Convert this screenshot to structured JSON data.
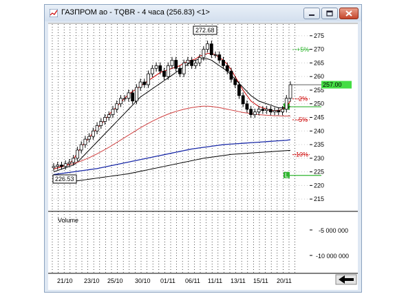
{
  "window": {
    "title": "ГАЗПРОМ ао - TQBR - 4 часа (256.83) <1>"
  },
  "icons": {
    "app": "chart-icon",
    "minimize": "minimize-icon",
    "maximize": "maximize-icon",
    "close": "close-icon",
    "scroll": "scroll-left-arrow-icon"
  },
  "colors": {
    "up_candle": "#ffffff",
    "down_candle": "#000000",
    "ma_fast": "#cc0000",
    "ma_slow": "#000000",
    "ma_50": "#d04040",
    "ma_100": "#1a2aa8",
    "ma_200": "#000000",
    "level_green": "#2fb52f",
    "level_red": "#cc0000",
    "price_badge": "#44dd44"
  },
  "price_panel": {
    "y_ticks": [
      "275",
      "270",
      "265",
      "260",
      "255",
      "250",
      "245",
      "240",
      "235",
      "230",
      "225",
      "220",
      "215"
    ],
    "current_price_label": "257.00",
    "high_label": "272.68",
    "low_label": "226.53",
    "pct_labels": [
      {
        "text": "+5%",
        "value": 269.9
      },
      {
        "text": "-2%",
        "value": 251.8
      },
      {
        "text": "-5%",
        "value": 244.1
      },
      {
        "text": "-10%",
        "value": 231.3
      }
    ],
    "order_markers": [
      {
        "text": "L",
        "price": 248.9
      },
      {
        "text": "L",
        "price": 223.7
      }
    ]
  },
  "volume_panel": {
    "label": "Volume",
    "y_ticks": [
      "-5 000 000",
      "-10 000 000"
    ]
  },
  "x_axis": {
    "labels": [
      "21/10",
      "23/10",
      "25/10",
      "30/10",
      "01/11",
      "06/11",
      "11/11",
      "13/11",
      "15/11",
      "20/11"
    ]
  },
  "chart_data": {
    "type": "candlestick",
    "title": "ГАЗПРОМ ао - TQBR - 4 часа (256.83) <1>",
    "ylim": [
      212,
      278
    ],
    "x_labels": [
      "21/10",
      "23/10",
      "25/10",
      "30/10",
      "01/11",
      "06/11",
      "11/11",
      "13/11",
      "15/11",
      "20/11"
    ],
    "closes": [
      227,
      227.5,
      227,
      228,
      228.5,
      230,
      233,
      235,
      237,
      238,
      240,
      242,
      243.5,
      245,
      246,
      248,
      250,
      252,
      252,
      254,
      251,
      256,
      258,
      257,
      261,
      263,
      264,
      262,
      260,
      264,
      266,
      263,
      261,
      265,
      266,
      264,
      265,
      267,
      270,
      272,
      268,
      268,
      266,
      264,
      262,
      259,
      257,
      253,
      250,
      248,
      246,
      247,
      248,
      247.5,
      248,
      247,
      247.5,
      247,
      248,
      252,
      257
    ],
    "series": [
      {
        "name": "",
        "values": [
          226,
          226.5,
          227,
          227.5,
          228,
          229.5,
          232,
          234,
          236,
          237.5,
          239.5,
          241,
          242.5,
          244,
          246,
          247.5,
          249,
          250.5,
          252,
          253.5,
          254.5,
          255.5,
          256.5,
          257.5,
          258.5,
          259.5,
          260.5,
          261.5,
          262,
          262.5,
          263,
          263.5,
          264,
          265,
          265.5,
          266,
          266.5,
          267.5,
          268,
          268.5,
          268.5,
          268,
          267,
          266,
          264.5,
          262.5,
          260,
          257.5,
          255,
          253,
          251,
          250,
          249,
          248.5,
          248,
          247.5,
          247.5,
          247.5,
          248,
          249,
          251
        ]
      },
      {
        "name": "",
        "values": [
          225,
          225.5,
          226,
          226.5,
          227,
          227.5,
          228.5,
          230,
          231.5,
          233,
          234.5,
          236,
          237.5,
          239,
          240.5,
          242,
          243.5,
          245,
          246.5,
          248,
          249.5,
          251,
          252.5,
          253.5,
          254.5,
          255.5,
          256.5,
          257.5,
          258.5,
          259.5,
          260.5,
          261.5,
          262.5,
          263.5,
          264.5,
          265.5,
          266,
          266.5,
          266.5,
          266.5,
          266,
          265,
          264,
          263,
          262,
          260.5,
          259,
          257.5,
          256,
          254.5,
          253,
          252,
          251,
          250.5,
          250,
          249.5,
          249,
          248.5,
          248.5,
          248.5,
          249
        ]
      },
      {
        "name": "",
        "values": [
          226,
          226.4,
          226.8,
          227.2,
          227.6,
          228,
          228.5,
          229,
          229.6,
          230.2,
          230.9,
          231.6,
          232.4,
          233.2,
          234,
          234.9,
          235.8,
          236.7,
          237.6,
          238.5,
          239.4,
          240.3,
          241.2,
          242,
          242.8,
          243.6,
          244.3,
          245,
          245.6,
          246.2,
          246.7,
          247.2,
          247.6,
          248,
          248.3,
          248.6,
          248.8,
          249,
          249.1,
          249.1,
          249,
          248.8,
          248.6,
          248.3,
          248,
          247.7,
          247.4,
          247.1,
          246.8,
          246.6,
          246.4,
          246.2,
          246,
          245.9,
          245.8,
          245.7,
          245.6,
          245.6,
          245.5,
          245.5,
          245.5
        ]
      },
      {
        "name": "",
        "values": [
          224,
          224.2,
          224.4,
          224.6,
          224.8,
          225,
          225.2,
          225.4,
          225.6,
          225.8,
          226,
          226.2,
          226.5,
          226.8,
          227.1,
          227.4,
          227.7,
          228,
          228.3,
          228.6,
          228.9,
          229.2,
          229.5,
          229.8,
          230.1,
          230.4,
          230.7,
          231,
          231.3,
          231.6,
          231.9,
          232.2,
          232.5,
          232.8,
          233.1,
          233.4,
          233.6,
          233.8,
          234,
          234.2,
          234.4,
          234.6,
          234.8,
          235,
          235.1,
          235.2,
          235.3,
          235.4,
          235.5,
          235.6,
          235.7,
          235.8,
          235.9,
          236,
          236.1,
          236.2,
          236.3,
          236.4,
          236.5,
          236.6,
          236.8
        ]
      },
      {
        "name": "",
        "values": [
          221,
          221.1,
          221.2,
          221.3,
          221.4,
          221.5,
          221.7,
          221.9,
          222.1,
          222.3,
          222.5,
          222.7,
          222.9,
          223.1,
          223.3,
          223.5,
          223.7,
          223.9,
          224.1,
          224.3,
          224.6,
          224.9,
          225.2,
          225.5,
          225.8,
          226.1,
          226.4,
          226.7,
          227,
          227.3,
          227.6,
          227.9,
          228.2,
          228.5,
          228.8,
          229.1,
          229.4,
          229.7,
          230,
          230.2,
          230.4,
          230.6,
          230.8,
          231,
          231.2,
          231.4,
          231.5,
          231.6,
          231.7,
          231.8,
          231.9,
          232,
          232.1,
          232.2,
          232.3,
          232.4,
          232.5,
          232.6,
          232.7,
          232.8,
          232.9
        ]
      }
    ],
    "grid": true
  }
}
